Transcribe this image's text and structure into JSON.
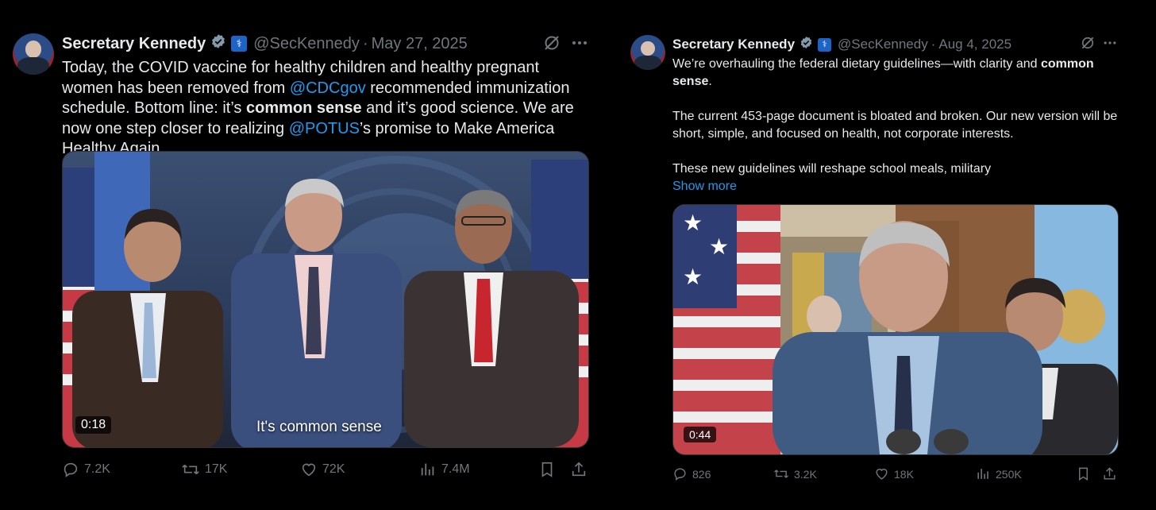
{
  "tweets": [
    {
      "author_name": "Secretary Kennedy",
      "handle": "@SecKennedy",
      "separator": "·",
      "date": "May 27, 2025",
      "text_parts": {
        "p1": "Today, the COVID vaccine for healthy children and healthy pregnant women has been removed from ",
        "link1": "@CDCgov",
        "p2": " recommended immunization schedule. Bottom line: it’s ",
        "bold1": "common sense",
        "p3": " and it’s good science. We are now one step closer to realizing ",
        "link2": "@POTUS",
        "p4": "’s promise to Make America Healthy Again."
      },
      "video": {
        "duration": "0:18",
        "caption": "It's common sense"
      },
      "stats": {
        "replies": "7.2K",
        "reposts": "17K",
        "likes": "72K",
        "views": "7.4M"
      }
    },
    {
      "author_name": "Secretary Kennedy",
      "handle": "@SecKennedy",
      "separator": "·",
      "date": "Aug 4, 2025",
      "text_parts": {
        "p1": "We’re overhauling the federal dietary guidelines—with clarity and ",
        "bold1": "common sense",
        "p2": ".",
        "para2": "The current 453-page document is bloated and broken. Our new version will be short, simple, and focused on health, not corporate interests.",
        "para3": "These new guidelines will reshape school meals, military",
        "show_more": "Show more"
      },
      "video": {
        "duration": "0:44"
      },
      "stats": {
        "replies": "826",
        "reposts": "3.2K",
        "likes": "18K",
        "views": "250K"
      }
    }
  ],
  "colors": {
    "background": "#000000",
    "text": "#e7e9ea",
    "muted": "#71767b",
    "link": "#1d9bf0"
  },
  "icons": [
    "verified-badge-icon",
    "government-badge-icon",
    "grok-icon",
    "more-icon",
    "reply-icon",
    "repost-icon",
    "like-icon",
    "views-icon",
    "bookmark-icon",
    "share-icon"
  ]
}
